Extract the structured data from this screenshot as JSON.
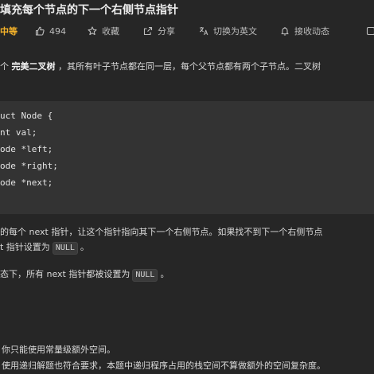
{
  "problem": {
    "title": "填充每个节点的下一个右侧节点指针"
  },
  "toolbar": {
    "difficulty": "中等",
    "like_count": "494",
    "favorite_label": "收藏",
    "share_label": "分享",
    "translate_label": "切换为英文",
    "notify_label": "接收动态",
    "icons": {
      "like": "thumbs-up-icon",
      "favorite": "star-icon",
      "share": "share-icon",
      "translate": "translate-icon",
      "notify": "bell-icon"
    },
    "difficulty_color": "#f5b32a"
  },
  "description": {
    "line1_prefix": "个 ",
    "line1_bold": "完美二叉树",
    "line1_suffix": " ，其所有叶子节点都在同一层，每个父节点都有两个子节点。二叉树"
  },
  "code": {
    "lines": [
      "uct Node {",
      "nt val;",
      "ode *left;",
      "ode *right;",
      "ode *next;"
    ]
  },
  "body": {
    "para1_line1": "的每个 next 指针，让这个指针指向其下一个右侧节点。如果找不到下一个右侧节点",
    "para1_line2_prefix": "t 指针设置为",
    "para1_line2_code": "NULL",
    "para1_line2_suffix": "。",
    "para2_prefix": "态下，所有 next 指针都被设置为",
    "para2_code": "NULL",
    "para2_suffix": "。"
  },
  "advanced": {
    "item1": "你只能使用常量级额外空间。",
    "item2": "使用递归解题也符合要求，本题中递归程序占用的栈空间不算做额外的空间复杂度。"
  }
}
